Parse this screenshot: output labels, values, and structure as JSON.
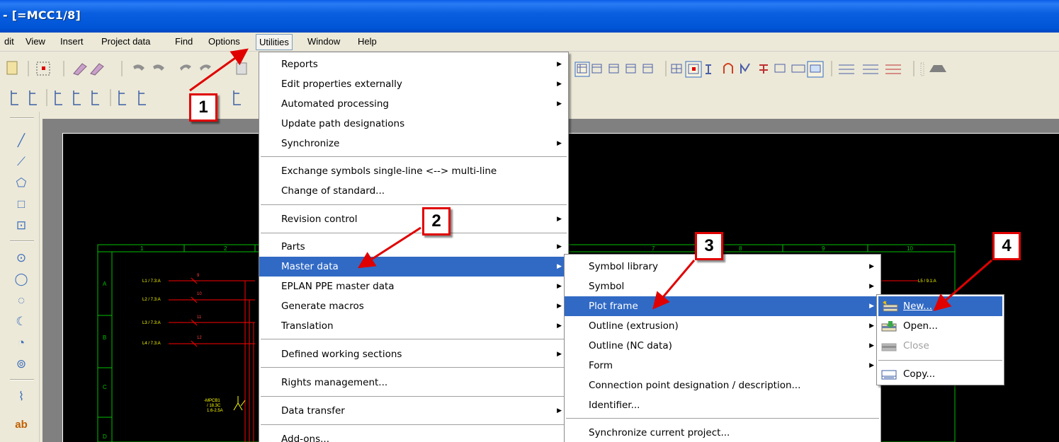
{
  "window": {
    "title": "- [=MCC1/8]"
  },
  "menubar": [
    "dit",
    "View",
    "Insert",
    "Project data",
    "Find",
    "Options",
    "Utilities",
    "Window",
    "Help"
  ],
  "utilities_menu": [
    {
      "label": "Reports",
      "submenu": true
    },
    {
      "label": "Edit properties externally",
      "submenu": true
    },
    {
      "label": "Automated processing",
      "submenu": true
    },
    {
      "label": "Update path designations",
      "submenu": false
    },
    {
      "label": "Synchronize",
      "submenu": true
    },
    {
      "label": "Exchange symbols single-line <--> multi-line",
      "submenu": false
    },
    {
      "label": "Change of standard...",
      "submenu": false
    },
    {
      "label": "Revision control",
      "submenu": true
    },
    {
      "label": "Parts",
      "submenu": true
    },
    {
      "label": "Master data",
      "submenu": true,
      "highlighted": true
    },
    {
      "label": "EPLAN PPE master data",
      "submenu": true
    },
    {
      "label": "Generate macros",
      "submenu": true
    },
    {
      "label": "Translation",
      "submenu": true
    },
    {
      "label": "Defined working sections",
      "submenu": true
    },
    {
      "label": "Rights management...",
      "submenu": false
    },
    {
      "label": "Data transfer",
      "submenu": true
    },
    {
      "label": "Add-ons...",
      "submenu": false
    }
  ],
  "master_data_menu": [
    {
      "label": "Symbol library",
      "submenu": true
    },
    {
      "label": "Symbol",
      "submenu": true
    },
    {
      "label": "Plot frame",
      "submenu": true,
      "highlighted": true
    },
    {
      "label": "Outline (extrusion)",
      "submenu": true
    },
    {
      "label": "Outline (NC data)",
      "submenu": true
    },
    {
      "label": "Form",
      "submenu": true
    },
    {
      "label": "Connection point designation / description...",
      "submenu": false
    },
    {
      "label": "Identifier...",
      "submenu": false
    },
    {
      "label": "Synchronize current project...",
      "submenu": false
    }
  ],
  "plot_frame_menu": [
    {
      "label": "New...",
      "icon": "new-plot-frame-icon",
      "highlighted": true,
      "disabled": false
    },
    {
      "label": "Open...",
      "icon": "open-folder-icon",
      "highlighted": false,
      "disabled": false
    },
    {
      "label": "Close",
      "icon": "close-folder-icon",
      "highlighted": false,
      "disabled": true
    },
    {
      "label": "Copy...",
      "icon": "copy-plot-frame-icon",
      "highlighted": false,
      "disabled": false
    }
  ],
  "callouts": [
    "1",
    "2",
    "3",
    "4"
  ],
  "schematic": {
    "column_numbers": [
      "1",
      "2",
      "7",
      "8",
      "9",
      "10"
    ],
    "row_letters": [
      "A",
      "B",
      "C",
      "D"
    ],
    "line_labels": [
      "L1 / 7.3:A",
      "L2 / 7.3:A",
      "L3 / 7.3:A",
      "L4 / 7.3:A",
      "L5 / 9.1:A"
    ],
    "wire_numbers": [
      "9",
      "10",
      "11",
      "12"
    ],
    "breaker_label": "-MPCB1",
    "breaker_sub": [
      "/ 18.3C",
      "1.6-2.5A"
    ]
  },
  "colors": {
    "title_bar": "#0055d6",
    "menu_highlight": "#316ac5",
    "callout_border": "#e00000",
    "schematic_frame": "#00c000",
    "schematic_wire": "#ff0000"
  }
}
